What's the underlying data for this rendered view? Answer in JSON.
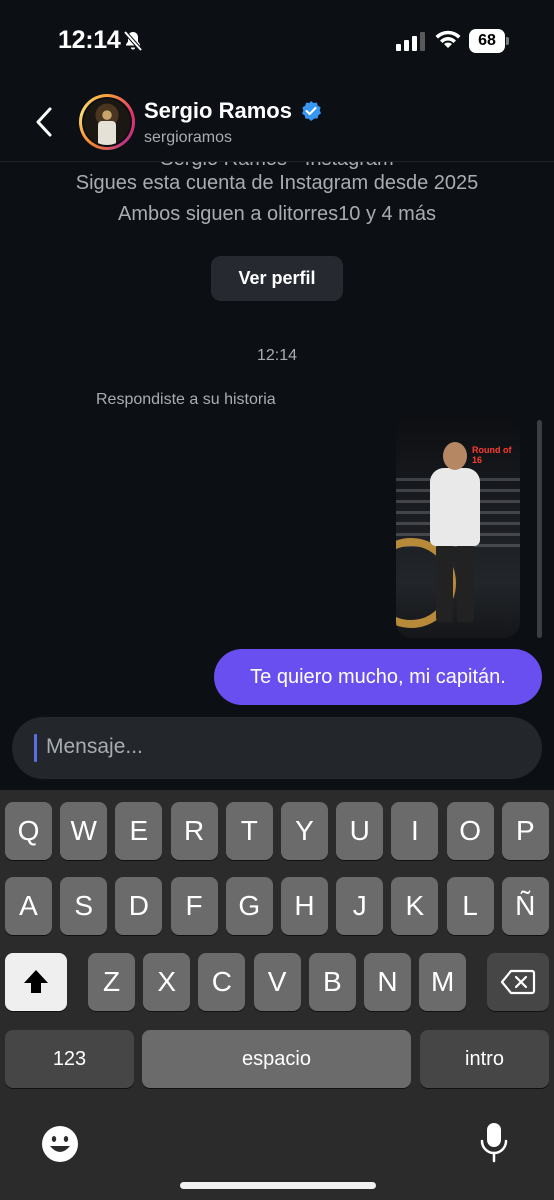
{
  "status_bar": {
    "time": "12:14",
    "battery_level": "68",
    "icons": [
      "bell-slash-icon",
      "signal-icon",
      "wifi-icon",
      "battery-icon"
    ]
  },
  "header": {
    "name": "Sergio Ramos",
    "username": "sergioramos",
    "icons": [
      "chevron-left-icon",
      "verified-badge-icon"
    ],
    "verified_color": "#3897f0"
  },
  "profile_info": {
    "clipped_line": "Sergio Ramos · Instagram",
    "follow_since": "Sigues esta cuenta de Instagram desde 2025",
    "mutuals": "Ambos siguen a olitorres10 y 4 más",
    "view_profile_label": "Ver perfil"
  },
  "chat": {
    "timestamp": "12:14",
    "story_reply_label": "Respondiste a su historia",
    "story_badge": "Round of 16",
    "messages": [
      {
        "text": "Te quiero mucho, mi capitán.",
        "sender": "me"
      }
    ],
    "bubble_color": "#6a4ff0"
  },
  "composer": {
    "placeholder": "Mensaje..."
  },
  "keyboard": {
    "row1": [
      "Q",
      "W",
      "E",
      "R",
      "T",
      "Y",
      "U",
      "I",
      "O",
      "P"
    ],
    "row2": [
      "A",
      "S",
      "D",
      "F",
      "G",
      "H",
      "J",
      "K",
      "L",
      "Ñ"
    ],
    "row3": [
      "Z",
      "X",
      "C",
      "V",
      "B",
      "N",
      "M"
    ],
    "numbers_label": "123",
    "space_label": "espacio",
    "return_label": "intro",
    "icons": [
      "shift-icon",
      "backspace-icon",
      "emoji-icon",
      "microphone-icon"
    ]
  }
}
